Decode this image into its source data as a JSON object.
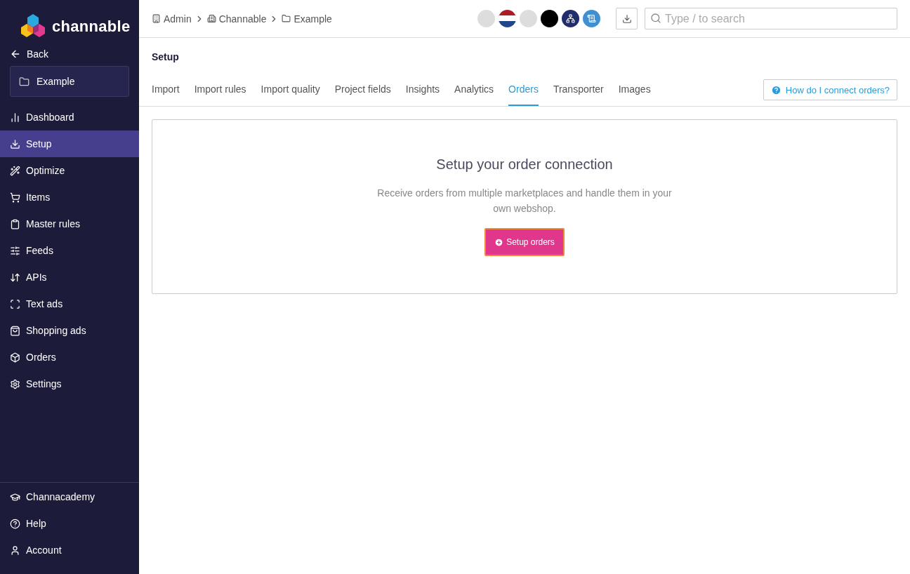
{
  "sidebar": {
    "logo": "channable",
    "back": "Back",
    "project": "Example",
    "items": [
      {
        "label": "Dashboard",
        "selected": false
      },
      {
        "label": "Setup",
        "selected": true
      },
      {
        "label": "Optimize",
        "selected": false
      },
      {
        "label": "Items",
        "selected": false
      },
      {
        "label": "Master rules",
        "selected": false
      },
      {
        "label": "Feeds",
        "selected": false
      },
      {
        "label": "APIs",
        "selected": false
      },
      {
        "label": "Text ads",
        "selected": false
      },
      {
        "label": "Shopping ads",
        "selected": false
      },
      {
        "label": "Orders",
        "selected": false
      },
      {
        "label": "Settings",
        "selected": false
      }
    ],
    "bottom_items": [
      {
        "label": "Channacademy"
      },
      {
        "label": "Help"
      },
      {
        "label": "Account"
      }
    ]
  },
  "breadcrumbs": [
    "Admin",
    "Channable",
    "Example"
  ],
  "avatars": [
    {
      "kind": "dot",
      "color": "#dddddd"
    },
    {
      "kind": "flag",
      "color": "#ae1c28"
    },
    {
      "kind": "dot",
      "color": "#dddddd"
    },
    {
      "kind": "dot",
      "color": "#000000"
    },
    {
      "kind": "network",
      "color": "#222d6b"
    },
    {
      "kind": "document",
      "color": "#3f8fd3"
    }
  ],
  "search": {
    "placeholder": "Type / to search"
  },
  "page_title": "Setup",
  "tabs": [
    {
      "label": "Import",
      "selected": false
    },
    {
      "label": "Import rules",
      "selected": false
    },
    {
      "label": "Import quality",
      "selected": false
    },
    {
      "label": "Project fields",
      "selected": false
    },
    {
      "label": "Insights",
      "selected": false
    },
    {
      "label": "Analytics",
      "selected": false
    },
    {
      "label": "Orders",
      "selected": true
    },
    {
      "label": "Transporter",
      "selected": false
    },
    {
      "label": "Images",
      "selected": false
    }
  ],
  "help_button": "How do I connect orders?",
  "card": {
    "title": "Setup your order connection",
    "description": "Receive orders from multiple marketplaces and handle them in your own webshop.",
    "button": "Setup orders"
  }
}
